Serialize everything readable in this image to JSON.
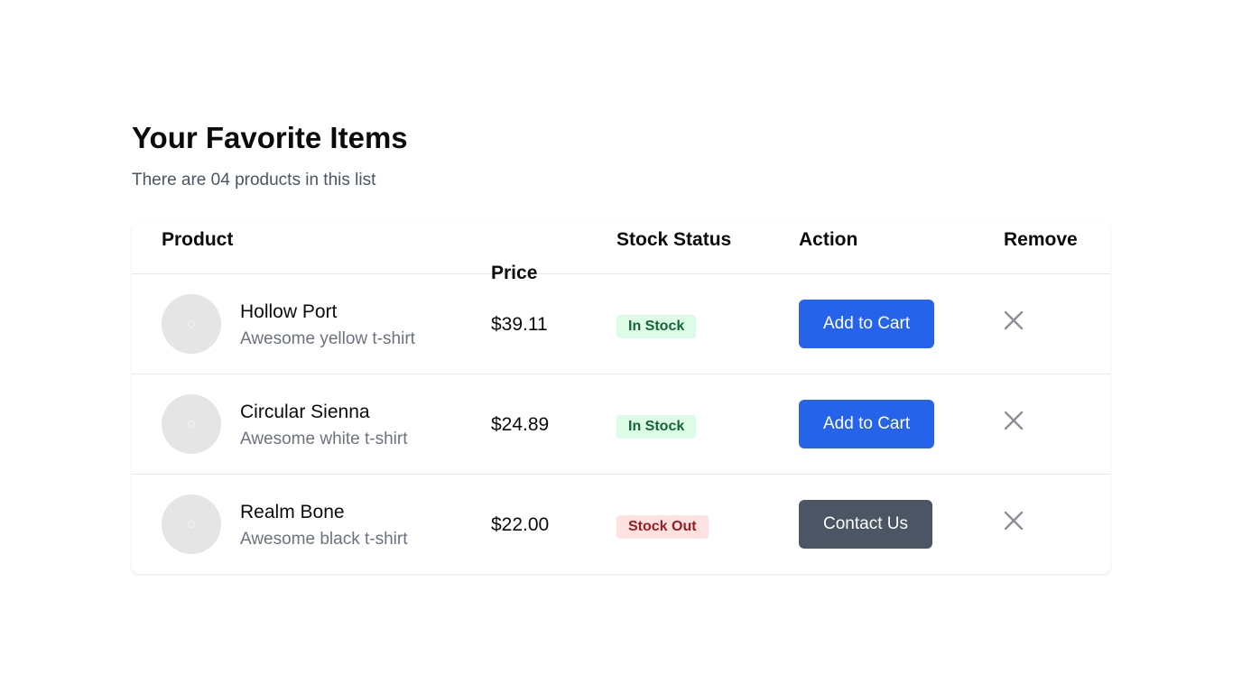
{
  "header": {
    "title": "Your Favorite Items",
    "subtitle": "There are 04 products in this list"
  },
  "table": {
    "columns": {
      "product": "Product",
      "price": "Price",
      "stock": "Stock Status",
      "action": "Action",
      "remove": "Remove"
    },
    "rows": [
      {
        "name": "Hollow Port",
        "description": "Awesome yellow t-shirt",
        "price": "$39.11",
        "stock": "In Stock",
        "stock_state": "in",
        "action": "Add to Cart"
      },
      {
        "name": "Circular Sienna",
        "description": "Awesome white t-shirt",
        "price": "$24.89",
        "stock": "In Stock",
        "stock_state": "in",
        "action": "Add to Cart"
      },
      {
        "name": "Realm Bone",
        "description": "Awesome black t-shirt",
        "price": "$22.00",
        "stock": "Stock Out",
        "stock_state": "out",
        "action": "Contact Us"
      }
    ]
  },
  "icons": {
    "remove": "close-icon",
    "thumbnail": "image-placeholder"
  },
  "colors": {
    "primary_button": "#2563eb",
    "secondary_button": "#4b5563",
    "in_stock_bg": "#dcfce7",
    "in_stock_text": "#166534",
    "stock_out_bg": "#fee2e2",
    "stock_out_text": "#991b1b"
  }
}
